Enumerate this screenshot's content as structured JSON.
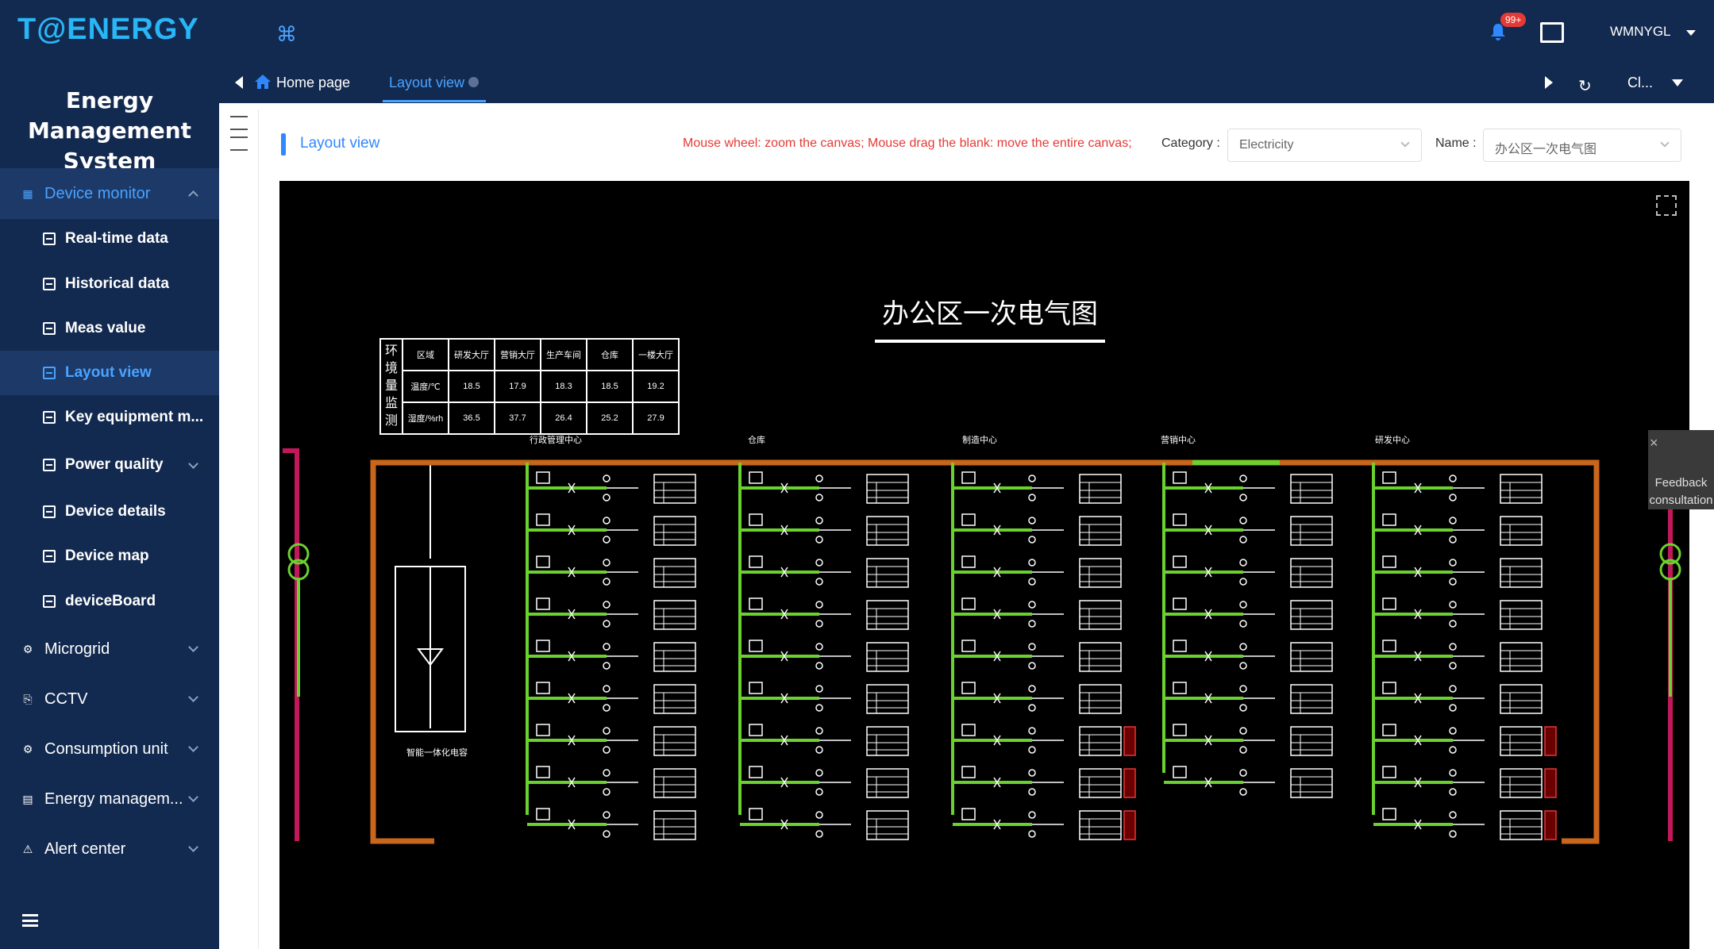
{
  "brand": {
    "logo": "T@ENERGY",
    "system_title": "Energy Management System"
  },
  "menu": {
    "device_monitor": "Device monitor",
    "realtime": "Real-time data",
    "historical": "Historical data",
    "meas": "Meas value",
    "layout": "Layout view",
    "key_equipment": "Key equipment m...",
    "power_quality": "Power quality",
    "device_details": "Device details",
    "device_map": "Device map",
    "device_board": "deviceBoard",
    "microgrid": "Microgrid",
    "cctv": "CCTV",
    "consumption": "Consumption unit",
    "energy_mgmt": "Energy managem...",
    "alert": "Alert center"
  },
  "header": {
    "badge": "99+",
    "user": "WMNYGL"
  },
  "tabs": {
    "home": "Home page",
    "layout": "Layout view",
    "close": "Cl..."
  },
  "page": {
    "title": "Layout view",
    "hint": "Mouse wheel: zoom the canvas; Mouse drag the blank: move the entire canvas;",
    "category_label": "Category :",
    "category_value": "Electricity",
    "name_label": "Name :",
    "name_value": "办公区一次电气图"
  },
  "diagram": {
    "title": "办公区一次电气图",
    "env_vertical": "环境量监测",
    "env_headers": [
      "区域",
      "研发大厅",
      "营销大厅",
      "生产车间",
      "仓库",
      "一楼大厅"
    ],
    "env_rows": [
      {
        "label": "温度/℃",
        "values": [
          "18.5",
          "17.9",
          "18.3",
          "18.5",
          "19.2"
        ]
      },
      {
        "label": "湿度/%rh",
        "values": [
          "36.5",
          "37.7",
          "26.4",
          "25.2",
          "27.9"
        ]
      }
    ],
    "sections": [
      "行政管理中心",
      "仓库",
      "制造中心",
      "营销中心",
      "研发中心"
    ],
    "cabinet_label": "智能一体化电容"
  },
  "feedback": {
    "label": "Feedback consultation"
  },
  "colors": {
    "sidebar": "#132a50",
    "accent": "#4aa3ff",
    "bus": "#c8661c",
    "feeder": "#6bd12f",
    "hint": "#e53935"
  }
}
